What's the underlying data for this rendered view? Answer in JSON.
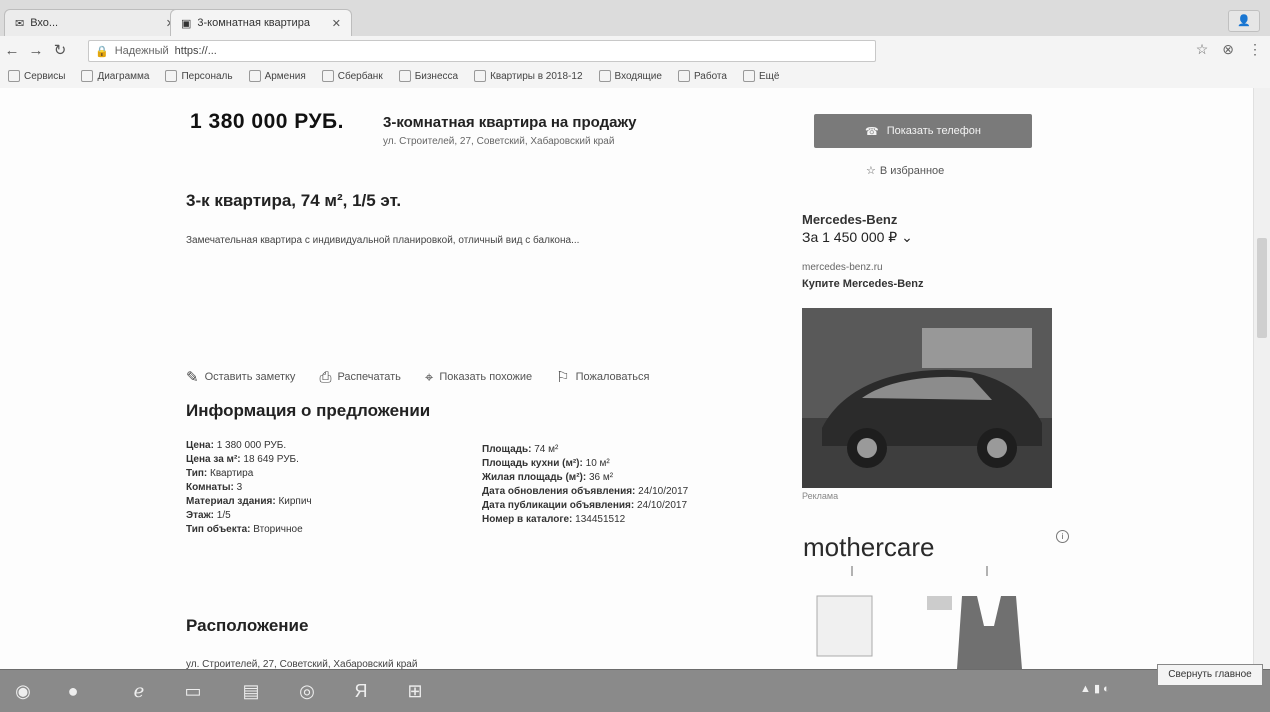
{
  "tabs": [
    {
      "label": "Вхо..."
    },
    {
      "label": "3-комнатная квартира"
    }
  ],
  "toolbar": {
    "secure_label": "Надежный",
    "url": "https://..."
  },
  "bookmarks": [
    "Сервисы",
    "Диаграмма",
    "Персональ",
    "Армения",
    "Сбербанк",
    "Бизнесса",
    "Квартиры в 2018-12",
    "Входящие",
    "Работа",
    "Ещё"
  ],
  "listing": {
    "price": "1 380 000 РУБ.",
    "title": "3-комнатная квартира на продажу",
    "address": "ул. Строителей, 27, Советский, Хабаровский край"
  },
  "apartment_heading": "3-к квартира, 74 м², 1/5 эт.",
  "description": "Замечательная квартира с индивидуальной планировкой, отличный вид с балкона...",
  "actions": [
    {
      "label": "Оставить заметку"
    },
    {
      "label": "Распечатать"
    },
    {
      "label": "Показать похожие"
    },
    {
      "label": "Пожаловаться"
    }
  ],
  "info": {
    "heading": "Информация о предложении",
    "left": [
      {
        "label": "Цена:",
        "value": "1 380 000 РУБ."
      },
      {
        "label": "Цена за м²:",
        "value": "18 649 РУБ."
      },
      {
        "label": "Тип:",
        "value": "Квартира"
      },
      {
        "label": "Комнаты:",
        "value": "3"
      },
      {
        "label": "Материал здания:",
        "value": "Кирпич"
      },
      {
        "label": "Этаж:",
        "value": "1/5"
      },
      {
        "label": "Тип объекта:",
        "value": "Вторичное"
      }
    ],
    "right": [
      {
        "label": "Площадь:",
        "value": "74 м²"
      },
      {
        "label": "Площадь кухни (м²):",
        "value": "10 м²"
      },
      {
        "label": "Жилая площадь (м²):",
        "value": "36 м²"
      },
      {
        "label": "Дата обновления объявления:",
        "value": "24/10/2017"
      },
      {
        "label": "Дата публикации объявления:",
        "value": "24/10/2017"
      },
      {
        "label": "Номер в каталоге:",
        "value": "134451512"
      }
    ]
  },
  "location": {
    "heading": "Расположение",
    "address": "ул. Строителей, 27, Советский, Хабаровский край"
  },
  "sidebar": {
    "show_phone": "Показать телефон",
    "favorite": "В избранное"
  },
  "ad": {
    "brand": "Mercedes-Benz",
    "price": "За 1 450 000 ₽",
    "url": "mercedes-benz.ru",
    "cta": "Купите Mercedes-Benz",
    "caption": "Реклама",
    "logo_text": "mothercare"
  },
  "taskbar": {
    "tooltip": "Свернуть главное"
  }
}
